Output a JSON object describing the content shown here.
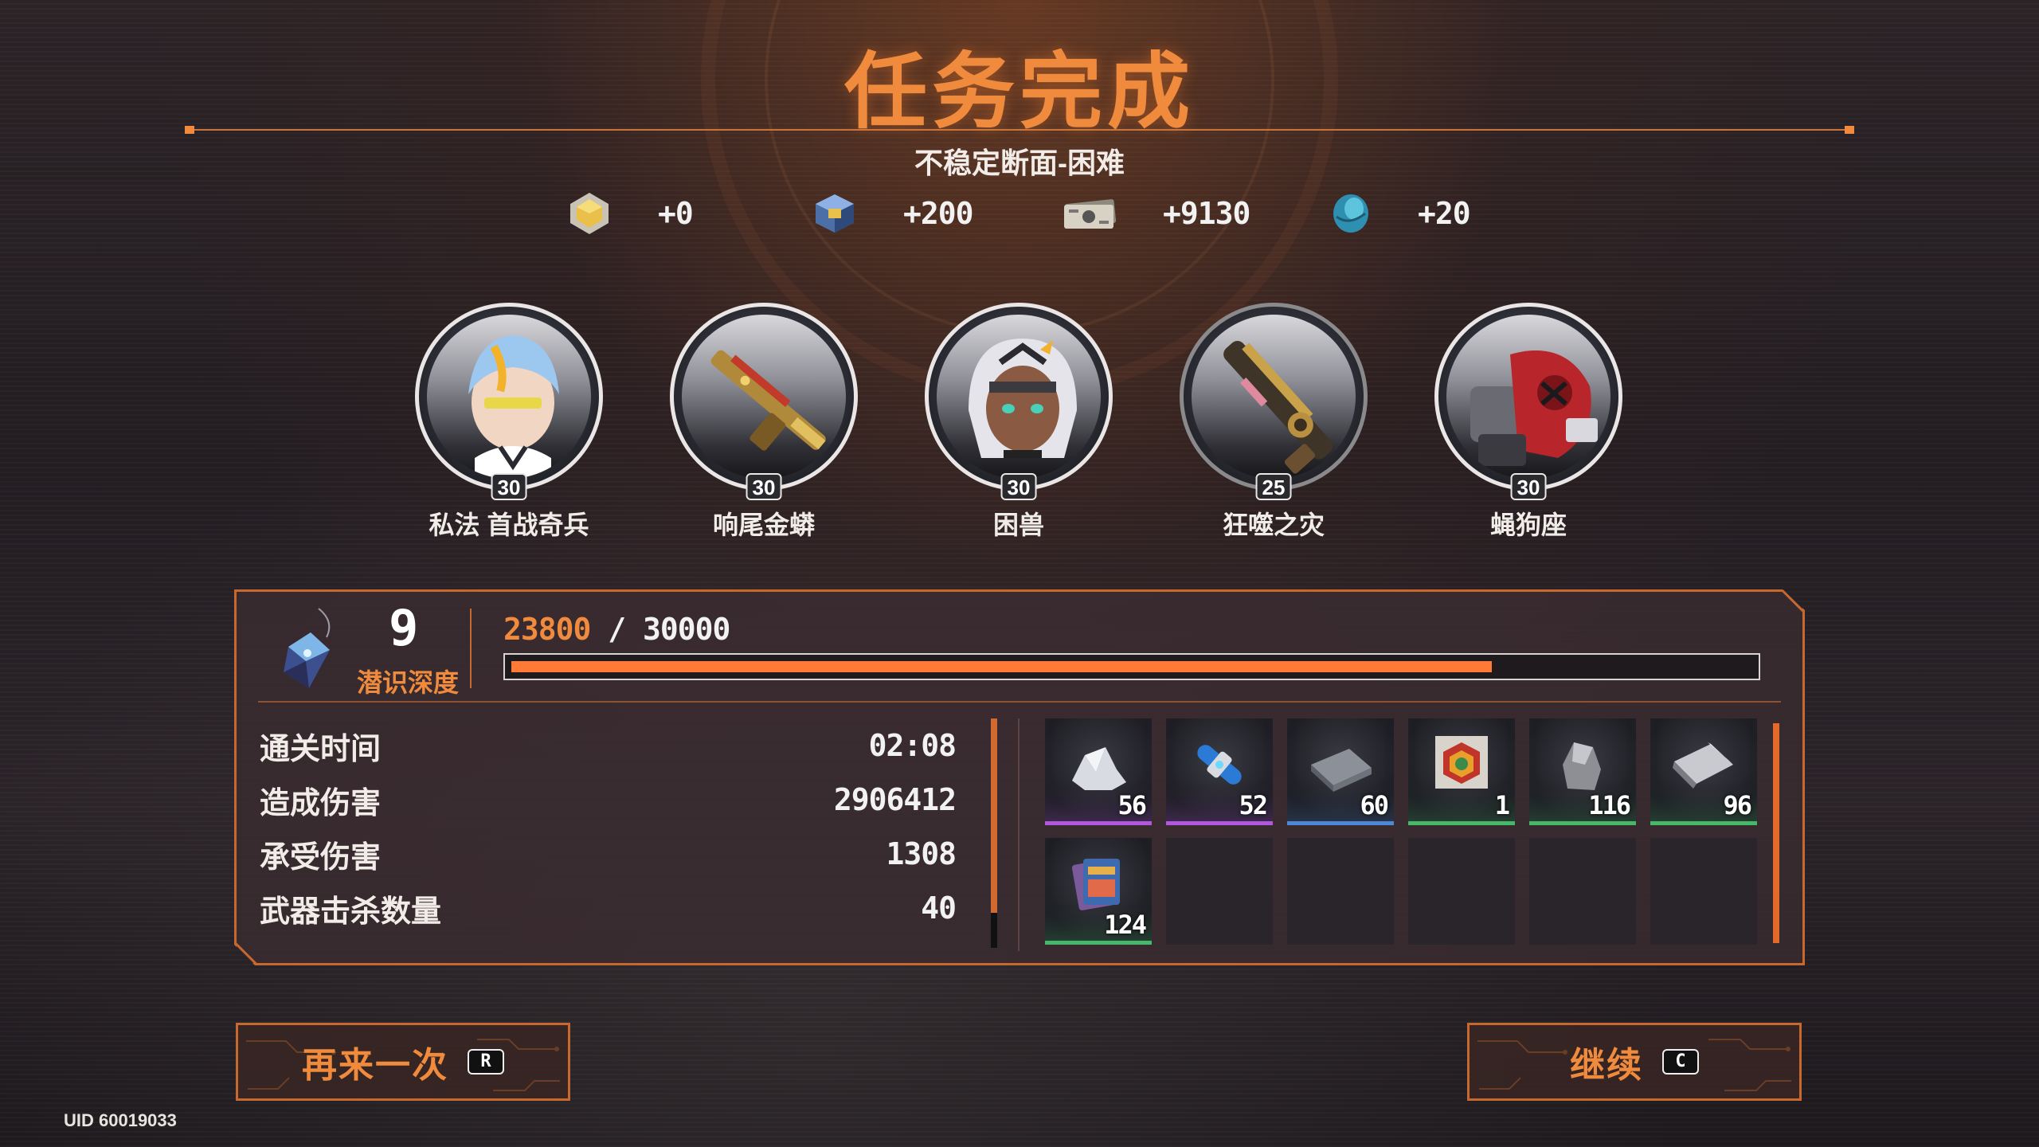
{
  "header": {
    "title": "任务完成",
    "subtitle": "不稳定断面-困难"
  },
  "rewards": [
    {
      "icon": "gold-cube-icon",
      "value": "+0"
    },
    {
      "icon": "blue-crate-icon",
      "value": "+200"
    },
    {
      "icon": "banknote-icon",
      "value": "+9130"
    },
    {
      "icon": "blue-shell-icon",
      "value": "+20"
    }
  ],
  "team": [
    {
      "name": "私法 首战奇兵",
      "level": "30"
    },
    {
      "name": "响尾金蟒",
      "level": "30"
    },
    {
      "name": "困兽",
      "level": "30"
    },
    {
      "name": "狂噬之灾",
      "level": "25"
    },
    {
      "name": "蝇狗座",
      "level": "30"
    }
  ],
  "depth": {
    "level": "9",
    "label": "潜识深度",
    "xp_current": "23800",
    "xp_max": "/ 30000",
    "progress": 0.79
  },
  "stats": [
    {
      "label": "通关时间",
      "value": "02:08"
    },
    {
      "label": "造成伤害",
      "value": "2906412"
    },
    {
      "label": "承受伤害",
      "value": "1308"
    },
    {
      "label": "武器击杀数量",
      "value": "40"
    }
  ],
  "items": [
    {
      "icon": "crystal-ore-icon",
      "qty": "56",
      "rarity": "#b457e0"
    },
    {
      "icon": "blue-capsule-icon",
      "qty": "52",
      "rarity": "#b457e0"
    },
    {
      "icon": "metal-plate-icon",
      "qty": "60",
      "rarity": "#4f86d6"
    },
    {
      "icon": "hex-badge-icon",
      "qty": "1",
      "rarity": "#46b86a"
    },
    {
      "icon": "stone-ore-icon",
      "qty": "116",
      "rarity": "#46b86a"
    },
    {
      "icon": "cloth-bundle-icon",
      "qty": "96",
      "rarity": "#46b86a"
    },
    {
      "icon": "card-pack-icon",
      "qty": "124",
      "rarity": "#46b86a"
    }
  ],
  "buttons": {
    "retry": "再来一次",
    "retry_key": "R",
    "continue": "继续",
    "continue_key": "C"
  },
  "footer": {
    "uid": "UID 60019033"
  }
}
